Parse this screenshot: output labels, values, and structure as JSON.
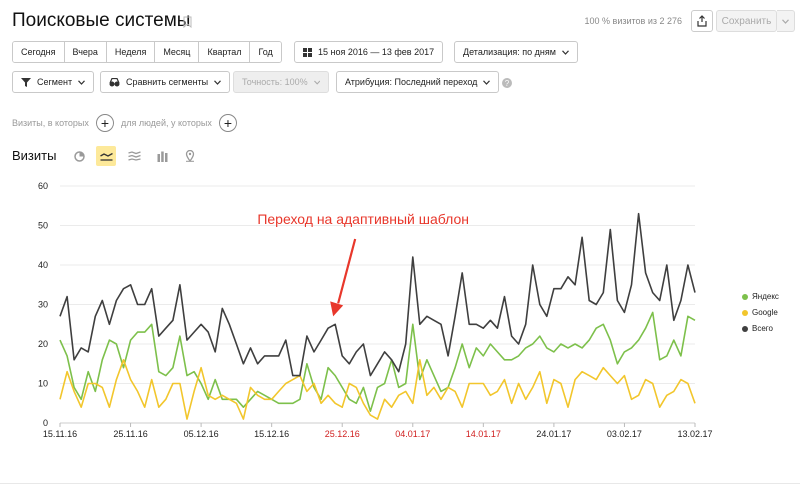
{
  "header": {
    "title": "Поисковые системы",
    "visits_stat": "100 % визитов из 2 276",
    "save_label": "Сохранить"
  },
  "period_tabs": [
    "Сегодня",
    "Вчера",
    "Неделя",
    "Месяц",
    "Квартал",
    "Год"
  ],
  "date_range": "15 ноя 2016 — 13 фев 2017",
  "detail": "Детализация: по дням",
  "toolbar": {
    "segment": "Сегмент",
    "compare": "Сравнить сегменты",
    "accuracy": "Точность: 100%",
    "attribution": "Атрибуция: Последний переход"
  },
  "conditions": {
    "visits_label": "Визиты, в которых",
    "people_label": "для людей, у которых"
  },
  "metric_label": "Визиты",
  "colors": {
    "yandex": "#7dc04b",
    "google": "#f2c62c",
    "total": "#3f3f3f",
    "annotation": "#e8372b",
    "holiday": "#d02020"
  },
  "chart_data": {
    "type": "line",
    "ylim": [
      0,
      60
    ],
    "yticks": [
      0,
      10,
      20,
      30,
      40,
      50,
      60
    ],
    "xticks": [
      {
        "label": "15.11.16",
        "index": 0,
        "holiday": false
      },
      {
        "label": "25.11.16",
        "index": 10,
        "holiday": false
      },
      {
        "label": "05.12.16",
        "index": 20,
        "holiday": false
      },
      {
        "label": "15.12.16",
        "index": 30,
        "holiday": false
      },
      {
        "label": "25.12.16",
        "index": 40,
        "holiday": true
      },
      {
        "label": "04.01.17",
        "index": 50,
        "holiday": true
      },
      {
        "label": "14.01.17",
        "index": 60,
        "holiday": true
      },
      {
        "label": "24.01.17",
        "index": 70,
        "holiday": false
      },
      {
        "label": "03.02.17",
        "index": 80,
        "holiday": false
      },
      {
        "label": "13.02.17",
        "index": 90,
        "holiday": false
      }
    ],
    "annotation": {
      "text": "Переход на  адаптивный шаблон",
      "index": 39,
      "value": 27
    },
    "series": [
      {
        "name": "Яндекс",
        "key": "yandex",
        "values": [
          21,
          17,
          9,
          6,
          13,
          8,
          16,
          21,
          20,
          14,
          21,
          23,
          23,
          25,
          13,
          12,
          14,
          22,
          12,
          13,
          10,
          6,
          11,
          6,
          6,
          6,
          4,
          6,
          8,
          7,
          6,
          5,
          5,
          5,
          6,
          15,
          9,
          6,
          14,
          12,
          9,
          6,
          5,
          9,
          3,
          9,
          10,
          16,
          9,
          10,
          25,
          11,
          16,
          12,
          8,
          9,
          14,
          20,
          14,
          19,
          17,
          20,
          18,
          16,
          16,
          17,
          19,
          20,
          22,
          19,
          18,
          20,
          19,
          20,
          19,
          21,
          24,
          25,
          21,
          15,
          18,
          19,
          21,
          24,
          28,
          16,
          17,
          21,
          17,
          27,
          26
        ]
      },
      {
        "name": "Google",
        "key": "google",
        "values": [
          6,
          13,
          8,
          4,
          10,
          10,
          9,
          4,
          11,
          16,
          11,
          8,
          4,
          11,
          4,
          6,
          10,
          10,
          1,
          8,
          14,
          7,
          6,
          7,
          6,
          5,
          1,
          9,
          7,
          6,
          6,
          8,
          10,
          11,
          12,
          8,
          10,
          5,
          7,
          5,
          4,
          10,
          9,
          5,
          2,
          1,
          6,
          4,
          7,
          8,
          5,
          16,
          7,
          9,
          6,
          9,
          8,
          4,
          10,
          10,
          10,
          7,
          8,
          11,
          5,
          10,
          6,
          9,
          13,
          5,
          11,
          10,
          4,
          11,
          13,
          12,
          11,
          14,
          12,
          10,
          12,
          6,
          7,
          11,
          10,
          4,
          7,
          8,
          11,
          10,
          5
        ]
      },
      {
        "name": "Всего",
        "key": "total",
        "values": [
          27,
          32,
          16,
          19,
          18,
          27,
          31,
          25,
          31,
          34,
          35,
          30,
          30,
          34,
          22,
          24,
          26,
          35,
          21,
          23,
          25,
          23,
          18,
          29,
          25,
          20,
          15,
          19,
          15,
          17,
          17,
          17,
          21,
          12,
          12,
          22,
          18,
          21,
          24,
          25,
          17,
          15,
          18,
          20,
          12,
          15,
          18,
          16,
          13,
          20,
          42,
          25,
          27,
          26,
          25,
          17,
          27,
          38,
          25,
          25,
          24,
          26,
          24,
          32,
          22,
          20,
          25,
          40,
          30,
          27,
          34,
          34,
          37,
          35,
          47,
          31,
          30,
          33,
          49,
          31,
          28,
          35,
          53,
          38,
          33,
          31,
          40,
          26,
          31,
          40,
          33
        ]
      }
    ]
  }
}
